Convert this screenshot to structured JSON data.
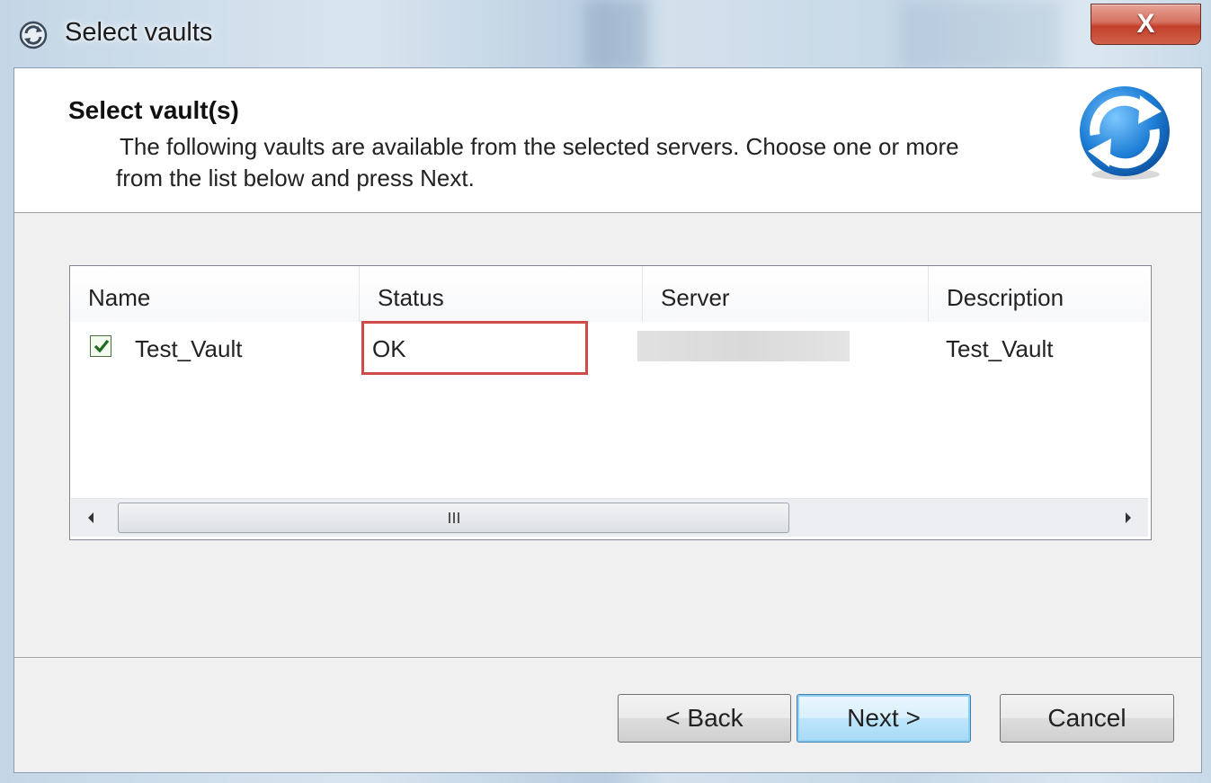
{
  "window": {
    "title": "Select vaults",
    "close_label": "X"
  },
  "header": {
    "title": "Select vault(s)",
    "description_line1": "The following vaults are available from the selected servers. Choose one or more",
    "description_line2": "from the list below and press Next."
  },
  "list": {
    "columns": [
      "Name",
      "Status",
      "Server",
      "Description"
    ],
    "rows": [
      {
        "checked": true,
        "name": "Test_Vault",
        "status": "OK",
        "server": "",
        "description": "Test_Vault"
      }
    ]
  },
  "buttons": {
    "back": "< Back",
    "next": "Next >",
    "cancel": "Cancel"
  },
  "icons": {
    "title": "sync-icon",
    "header": "sync-arrows-icon"
  },
  "colors": {
    "highlight_border": "#d14a4a",
    "default_button": "#a7d9f5"
  }
}
